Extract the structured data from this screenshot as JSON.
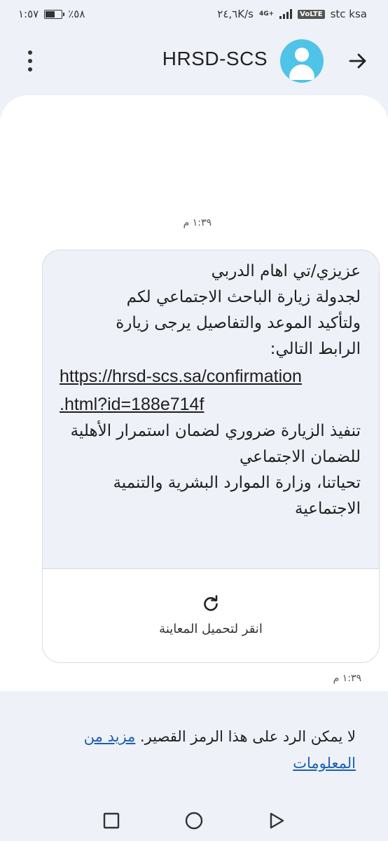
{
  "status_bar": {
    "time": "١:٥٧",
    "battery": "٪٥٨",
    "speed": "٢٤,٦K/s",
    "network_type": "4G+",
    "volte": "VoLTE",
    "carrier": "stc ksa"
  },
  "header": {
    "title": "HRSD-SCS",
    "avatar_icon": "person-icon",
    "back_icon": "arrow-right-icon",
    "menu_icon": "more-vert-icon"
  },
  "conversation": {
    "timestamp_1": "١:٣٩ م",
    "message": {
      "line_1": "عزيزي/تي اهام الدربي",
      "line_2": "لجدولة زيارة الباحث الاجتماعي لكم",
      "line_3": "ولتأكيد الموعد والتفاصيل يرجى زيارة",
      "line_4": "الرابط التالي:",
      "link_line_1": "https://hrsd-scs.sa/confirmation",
      "link_line_2": ".html?id=188e714f",
      "line_5": "تنفيذ الزيارة ضروري لضمان استمرار الأهلية",
      "line_6": "للضمان الاجتماعي",
      "line_7": "تحياتنا، وزارة الموارد البشرية والتنمية",
      "line_8": "الاجتماعية"
    },
    "preview": {
      "icon": "refresh-icon",
      "label": "انقر لتحميل المعاينة"
    },
    "timestamp_2": "١:٣٩ م"
  },
  "notice": {
    "text": "لا يمكن الرد على هذا الرمز القصير.",
    "link": "مزيد من المعلومات"
  },
  "nav_bar": {
    "recents_icon": "square-icon",
    "home_icon": "circle-icon",
    "back_icon": "triangle-back-icon"
  }
}
